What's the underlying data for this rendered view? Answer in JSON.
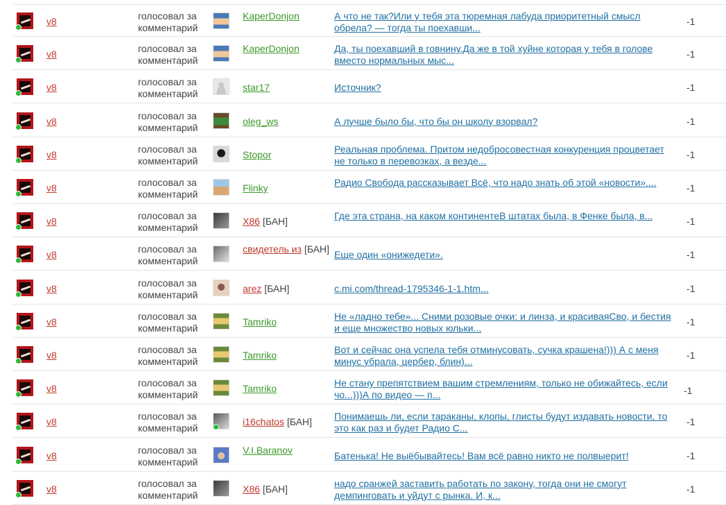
{
  "colors": {
    "voter_link": "#c0392b",
    "user_ok": "#3c9a2a",
    "user_banned": "#c0392b",
    "comment_link": "#1f6fa3",
    "online": "#2db838",
    "divider": "#e4e4e4"
  },
  "votes": [
    {
      "voter": "v8",
      "action": "голосовал за комментарий",
      "avatar": "pixel-face",
      "avatar_colors": [
        "#4a7ab8",
        "#f0c89a"
      ],
      "online": false,
      "user": "KaperDonjon",
      "banned": false,
      "ban_label": "",
      "comment": "А что не так?Или у тебя эта тюремная лабуда приоритетный смысл обрела? — тогда ты поехавши...",
      "score": "-1"
    },
    {
      "voter": "v8",
      "action": "голосовал за комментарий",
      "avatar": "pixel-face",
      "avatar_colors": [
        "#4a7ab8",
        "#f0c89a"
      ],
      "online": false,
      "user": "KaperDonjon",
      "banned": false,
      "ban_label": "",
      "comment": "Да, ты поехавший в говнину.Да же в той хуйне которая у тебя в голове вместо нормальных мыс...",
      "score": "-1"
    },
    {
      "voter": "v8",
      "action": "голосовал за комментарий",
      "avatar": "default-user",
      "avatar_colors": [
        "#e8e8e8",
        "#c8c8c8"
      ],
      "online": false,
      "user": "star17",
      "banned": false,
      "ban_label": "",
      "comment": "Источник?",
      "score": "-1"
    },
    {
      "voter": "v8",
      "action": "голосовал за комментарий",
      "avatar": "creeper",
      "avatar_colors": [
        "#6b4a2a",
        "#3c8a3c"
      ],
      "online": false,
      "user": "oleg_ws",
      "banned": false,
      "ban_label": "",
      "comment": "А лучше было бы, что бы он школу взорвал?",
      "score": "-1"
    },
    {
      "voter": "v8",
      "action": "голосовал за комментарий",
      "avatar": "portrait",
      "avatar_colors": [
        "#1a1a1a",
        "#d8d8d8"
      ],
      "online": false,
      "user": "Stopor",
      "banned": false,
      "ban_label": "",
      "comment": "Реальная проблема. Притом недобросовестная конкуренция процветает не только в перевозках, а везде...",
      "score": "-1"
    },
    {
      "voter": "v8",
      "action": "голосовал за комментарий",
      "avatar": "landscape",
      "avatar_colors": [
        "#9cc8e8",
        "#d8a870"
      ],
      "online": false,
      "user": "Flinky",
      "banned": false,
      "ban_label": "",
      "comment": "Радио Свобода рассказывает Всё, что надо знать об этой «новости»....",
      "score": "-1"
    },
    {
      "voter": "v8",
      "action": "голосовал за комментарий",
      "avatar": "photo-dark",
      "avatar_colors": [
        "#3a3a3a",
        "#9a9a9a"
      ],
      "online": false,
      "user": "X86",
      "banned": true,
      "ban_label": "[БАН]",
      "comment": "Где эта страна, на каком континентеВ штатах была, в Фенке была, в...",
      "score": "-1"
    },
    {
      "voter": "v8",
      "action": "голосовал за комментарий",
      "avatar": "photo-bw",
      "avatar_colors": [
        "#6a6a6a",
        "#e0e0e0"
      ],
      "online": false,
      "user": "свидетель из",
      "banned": true,
      "ban_label": "[БАН]",
      "comment": "Еще один «онижедети».",
      "score": "-1"
    },
    {
      "voter": "v8",
      "action": "голосовал за комментарий",
      "avatar": "photo-face",
      "avatar_colors": [
        "#8a5a4a",
        "#e8d0c0"
      ],
      "online": false,
      "user": "arez",
      "banned": true,
      "ban_label": "[БАН]",
      "comment": "c.mi.com/thread-1795346-1-1.htm...",
      "score": "-1"
    },
    {
      "voter": "v8",
      "action": "голосовал за комментарий",
      "avatar": "pixel-green",
      "avatar_colors": [
        "#6a8a3a",
        "#e8c870"
      ],
      "online": false,
      "user": "Tamriko",
      "banned": false,
      "ban_label": "",
      "comment": "Не «ладно тебе»... Сними розовые очки: и линза, и красиваяСво, и бестия и еще множество новых юльки...",
      "score": "-1"
    },
    {
      "voter": "v8",
      "action": "голосовал за комментарий",
      "avatar": "pixel-green",
      "avatar_colors": [
        "#6a8a3a",
        "#e8c870"
      ],
      "online": false,
      "user": "Tamriko",
      "banned": false,
      "ban_label": "",
      "comment": "Вот и сейчас она успела тебя отминусовать, сучка крашена!))) А с меня минус убрала, цербер, блин)...",
      "score": "-1"
    },
    {
      "voter": "v8",
      "action": "голосовал за комментарий",
      "avatar": "pixel-green",
      "avatar_colors": [
        "#6a8a3a",
        "#e8c870"
      ],
      "online": false,
      "user": "Tamriko",
      "banned": false,
      "ban_label": "",
      "comment": "Не стану препятствием вашим стремлениям, только не обижайтесь, если чо...)))А по видео — п...",
      "score": "-1"
    },
    {
      "voter": "v8",
      "action": "голосовал за комментарий",
      "avatar": "photo-bw",
      "avatar_colors": [
        "#5a5a5a",
        "#d8d8d8"
      ],
      "online": true,
      "user": "i16chatos",
      "banned": true,
      "ban_label": "[БАН]",
      "comment": "Понимаешь ли, если тараканы, клопы, глисты будут издавать новости, то это как раз и будет Радио С...",
      "score": "-1"
    },
    {
      "voter": "v8",
      "action": "голосовал за комментарий",
      "avatar": "photo-blue",
      "avatar_colors": [
        "#5a7ac8",
        "#e0c0a0"
      ],
      "online": false,
      "user": "V.I.Baranov",
      "banned": false,
      "ban_label": "",
      "comment": "Батенька! Не выёбывайтесь! Вам всё равно никто не полвыерит!",
      "score": "-1"
    },
    {
      "voter": "v8",
      "action": "голосовал за комментарий",
      "avatar": "photo-dark",
      "avatar_colors": [
        "#3a3a3a",
        "#9a9a9a"
      ],
      "online": false,
      "user": "X86",
      "banned": true,
      "ban_label": "[БАН]",
      "comment": "надо сранжей заставить работать по закону, тогда они не смогут демпинговать и уйдут с рынка. И, к...",
      "score": "-1"
    }
  ]
}
